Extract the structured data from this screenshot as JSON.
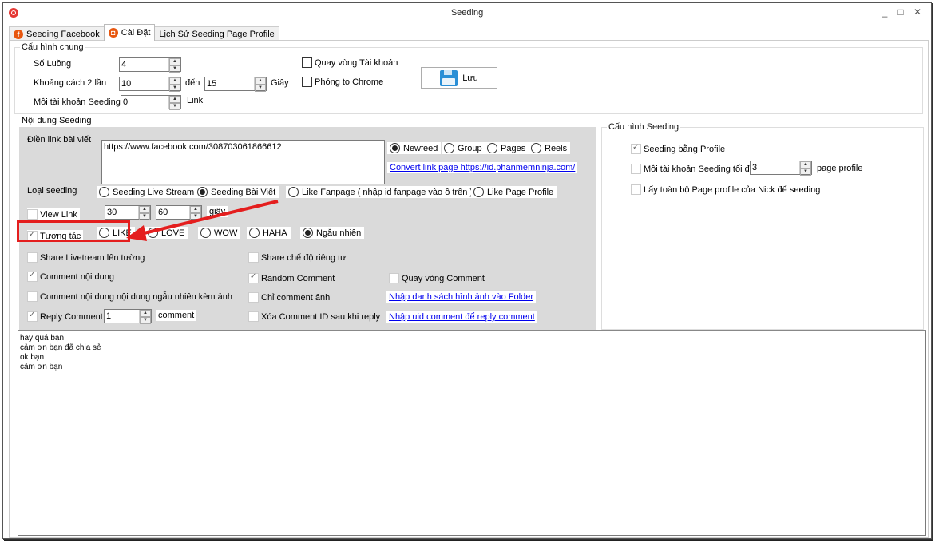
{
  "window": {
    "title": "Seeding",
    "controls": {
      "minimize": "_",
      "maximize": "□",
      "close": "✕"
    }
  },
  "tabs": [
    {
      "label": "Seeding Facebook",
      "icon": "facebook-icon",
      "glyph": "f",
      "active": false
    },
    {
      "label": "Cài Đặt",
      "icon": "settings-doc-icon",
      "glyph": "◘",
      "active": true
    },
    {
      "label": "Lịch Sử Seeding Page Profile",
      "active": false
    }
  ],
  "general_config": {
    "title": "Cấu hình chung",
    "threads_label": "Số Luồng",
    "threads_value": "4",
    "interval_label": "Khoảng cách 2 lần",
    "interval_from": "10",
    "interval_to_label": "đến",
    "interval_to": "15",
    "interval_unit": "Giây",
    "per_account_label": "Mỗi tài khoản Seeding",
    "per_account_value": "0",
    "per_account_unit": "Link",
    "rotate_accounts_label": "Quay vòng Tài khoản",
    "rotate_accounts_checked": false,
    "maximize_chrome_label": "Phóng to Chrome",
    "maximize_chrome_checked": false,
    "save_label": "Lưu"
  },
  "seeding_content": {
    "title": "Nội dung Seeding",
    "link_label": "Điền link bài viết",
    "link_value": "https://www.facebook.com/308703061866612",
    "source_options": [
      {
        "label": "Newfeed",
        "checked": true
      },
      {
        "label": "Group",
        "checked": false
      },
      {
        "label": "Pages",
        "checked": false
      },
      {
        "label": "Reels",
        "checked": false
      }
    ],
    "convert_link": "Convert link page https://id.phanmemninja.com/",
    "type_label": "Loại seeding",
    "type_options": [
      {
        "label": "Seeding Live Stream",
        "checked": false
      },
      {
        "label": "Seeding Bài Viết",
        "checked": true
      },
      {
        "label": "Like Fanpage ( nhập id fanpage vào ô trên )",
        "checked": false
      },
      {
        "label": "Like Page Profile",
        "checked": false
      }
    ],
    "view_link_label": "View Link",
    "view_link_checked": false,
    "view_from": "30",
    "view_to": "60",
    "view_unit": "giây",
    "interact_label": "Tương tác",
    "interact_checked": true,
    "reactions": [
      {
        "label": "LIKE",
        "checked": false
      },
      {
        "label": "LOVE",
        "checked": false
      },
      {
        "label": "WOW",
        "checked": false
      },
      {
        "label": "HAHA",
        "checked": false
      },
      {
        "label": "Ngẫu nhiên",
        "checked": true
      }
    ],
    "share_livestream_label": "Share Livetream lên tường",
    "share_livestream_checked": false,
    "share_private_label": "Share chế độ riêng tư",
    "share_private_checked": false,
    "comment_content_label": "Comment nội dung",
    "comment_content_checked": true,
    "random_comment_label": "Random Comment",
    "random_comment_checked": true,
    "rotate_comment_label": "Quay vòng Comment",
    "rotate_comment_checked": false,
    "comment_random_image_label": "Comment nội dung nội dung ngẫu nhiên kèm ảnh",
    "comment_random_image_checked": false,
    "image_only_label": "Chỉ comment ảnh",
    "image_only_checked": false,
    "image_folder_link": "Nhập danh sách hình ảnh vào Folder",
    "reply_comment_label": "Reply Comment",
    "reply_comment_checked": true,
    "reply_count": "1",
    "reply_unit": "comment",
    "delete_comment_id_label": "Xóa Comment ID sau khi reply",
    "delete_comment_id_checked": false,
    "reply_uid_link": "Nhập uid comment để reply comment"
  },
  "seeding_config": {
    "title": "Cấu hình Seeding",
    "by_profile_label": "Seeding bằng Profile",
    "by_profile_checked": true,
    "max_per_account_label": "Mỗi tài khoản Seeding tối đa",
    "max_per_account_checked": false,
    "max_per_account_value": "3",
    "max_per_account_unit": "page profile",
    "all_pages_label": "Lấy toàn bộ Page profile của Nick để seeding",
    "all_pages_checked": false
  },
  "comments": [
    "hay quá bạn",
    "cảm ơn bạn đã chia sẻ",
    "ok bạn",
    "cảm ơn bạn"
  ],
  "annotation_color": "#e41e1e"
}
